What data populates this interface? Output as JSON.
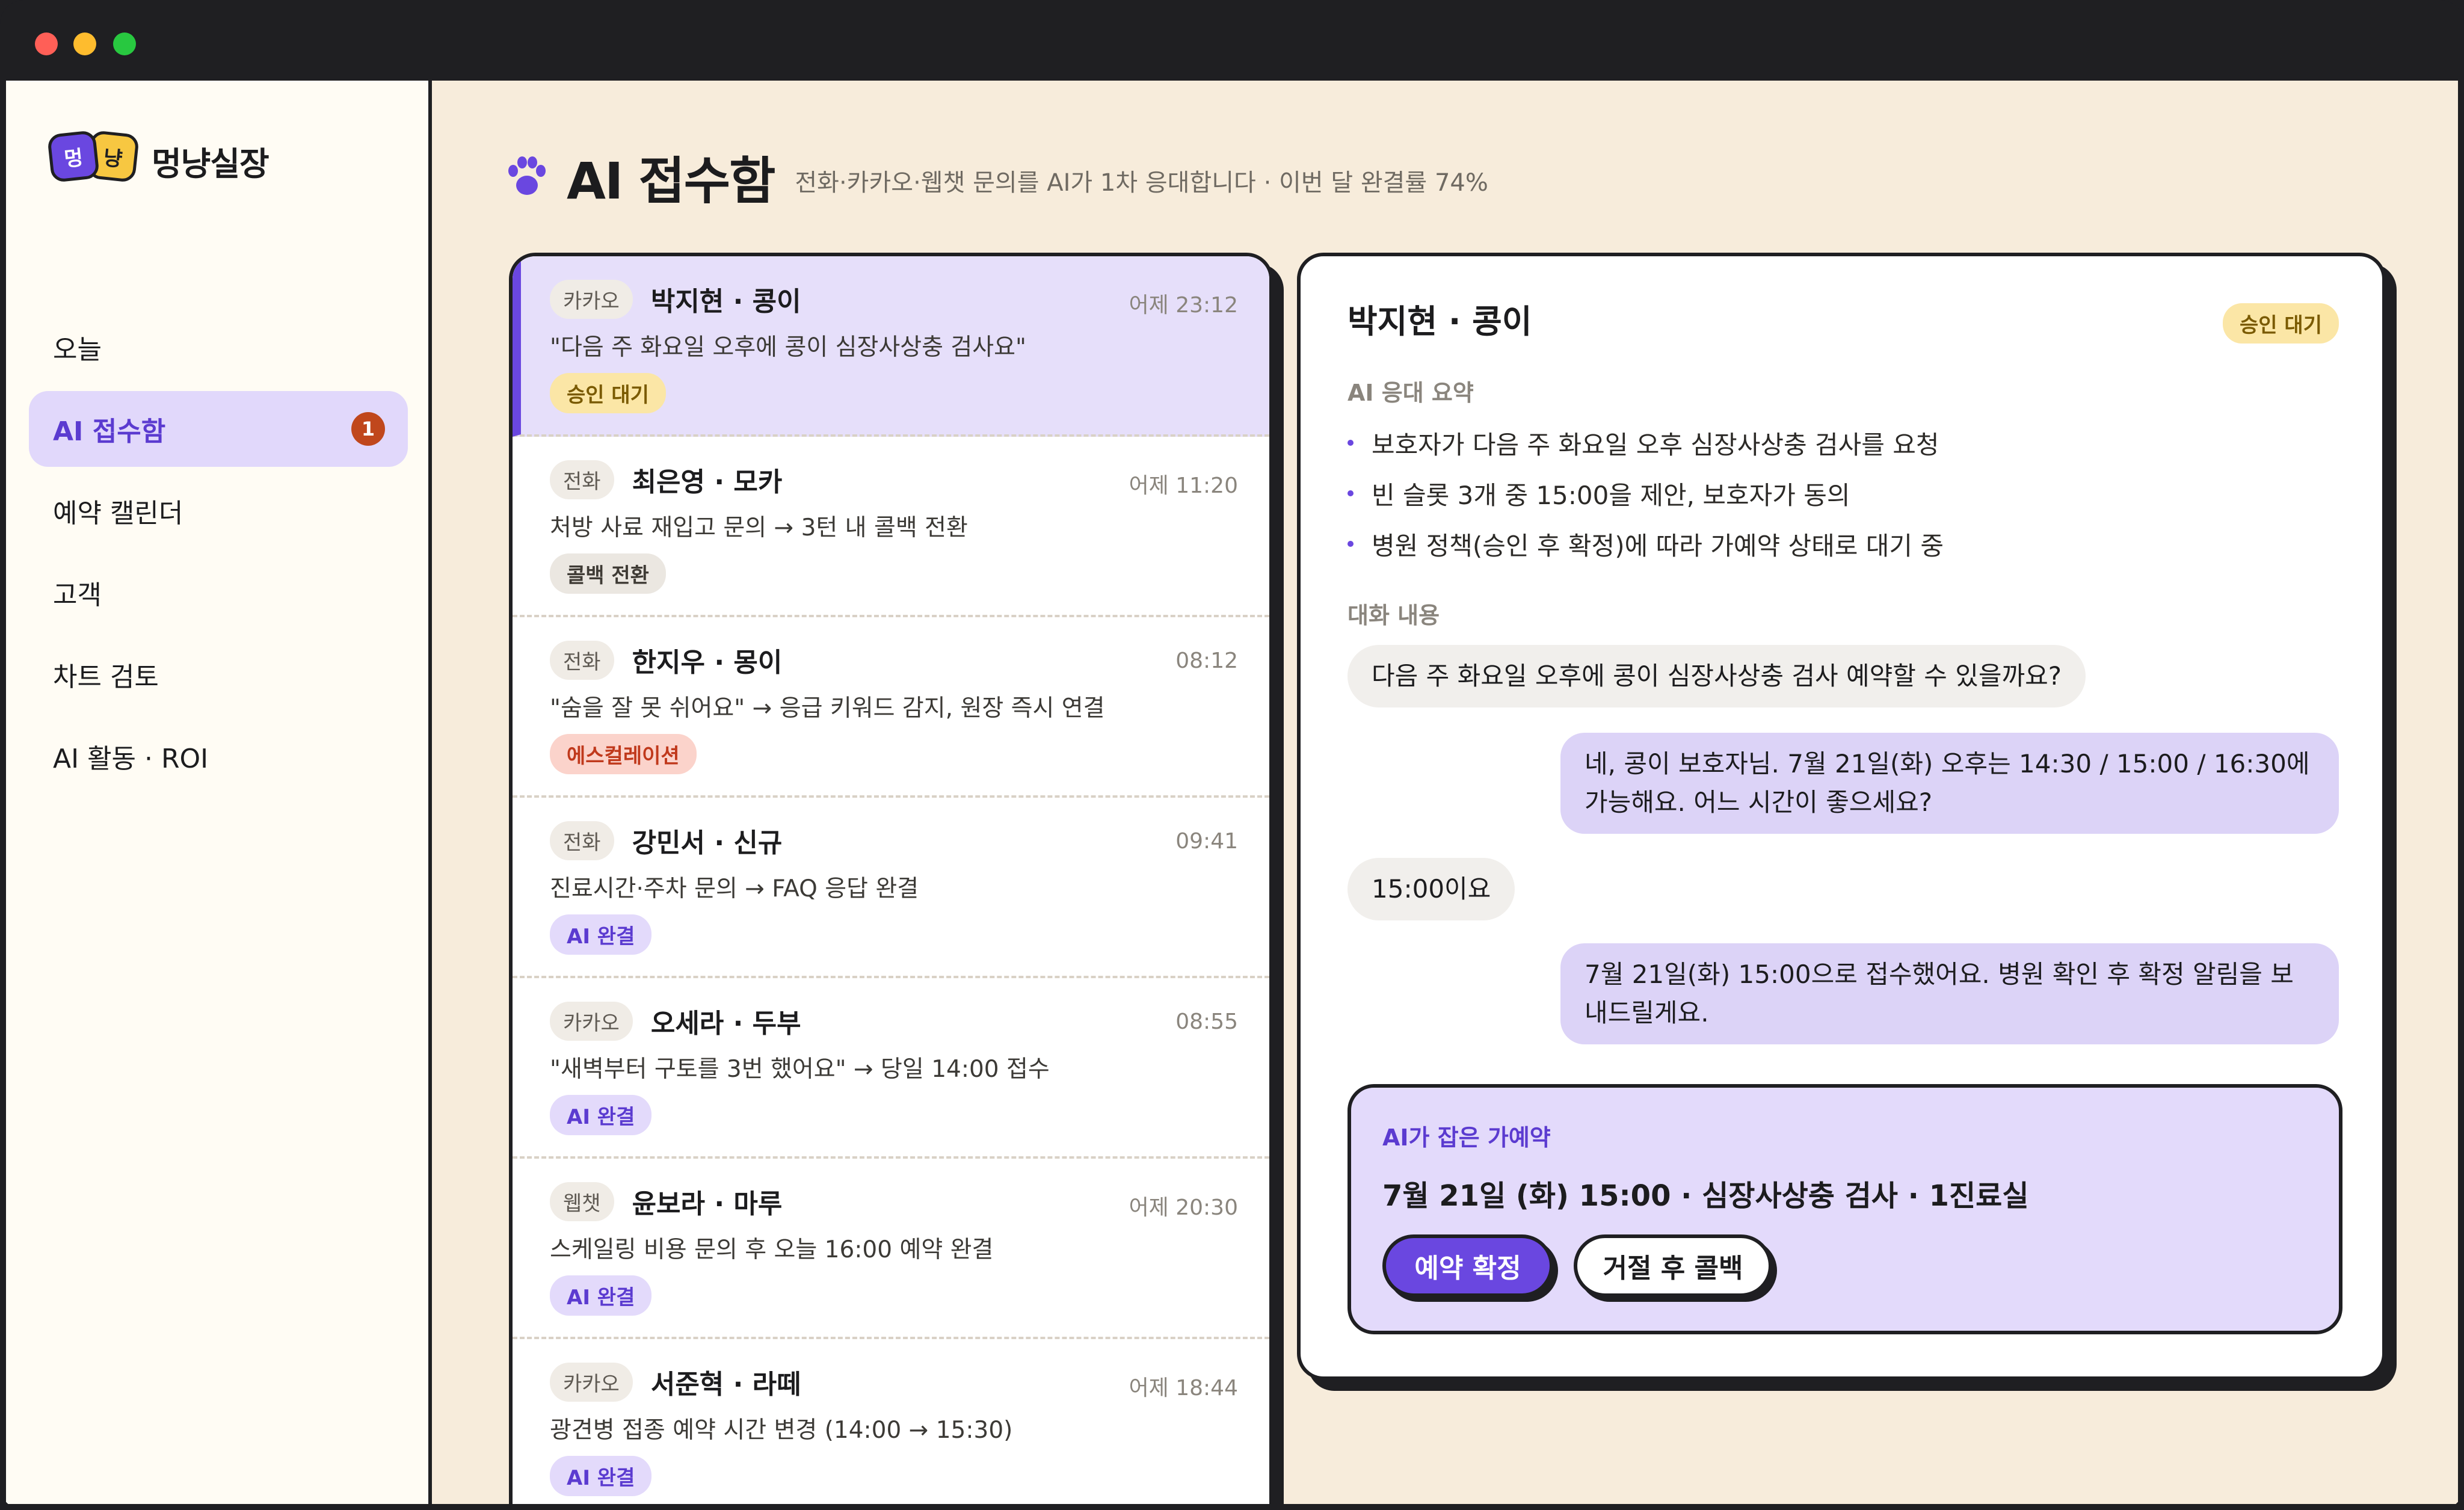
{
  "app": {
    "logo_badge_1": "멍",
    "logo_badge_2": "냥",
    "logo_text": "멍냥실장"
  },
  "sidebar": {
    "items": [
      {
        "label": "오늘"
      },
      {
        "label": "AI 접수함",
        "badge": "1"
      },
      {
        "label": "예약 캘린더"
      },
      {
        "label": "고객"
      },
      {
        "label": "차트 검토"
      },
      {
        "label": "AI 활동 · ROI"
      }
    ]
  },
  "header": {
    "title": "AI 접수함",
    "subtitle": "전화·카카오·웹챗 문의를 AI가 1차 응대합니다 · 이번 달 완결률 74%",
    "completion_rate_percent": 74
  },
  "inbox": {
    "items": [
      {
        "channel": "카카오",
        "name": "박지현 · 콩이",
        "time": "어제 23:12",
        "desc": "\"다음 주 화요일 오후에 콩이 심장사상충 검사요\"",
        "status": "승인 대기"
      },
      {
        "channel": "전화",
        "name": "최은영 · 모카",
        "time": "어제 11:20",
        "desc": "처방 사료 재입고 문의 → 3턴 내 콜백 전환",
        "status": "콜백 전환"
      },
      {
        "channel": "전화",
        "name": "한지우 · 몽이",
        "time": "08:12",
        "desc": "\"숨을 잘 못 쉬어요\" → 응급 키워드 감지, 원장 즉시 연결",
        "status": "에스컬레이션"
      },
      {
        "channel": "전화",
        "name": "강민서 · 신규",
        "time": "09:41",
        "desc": "진료시간·주차 문의 → FAQ 응답 완결",
        "status": "AI 완결"
      },
      {
        "channel": "카카오",
        "name": "오세라 · 두부",
        "time": "08:55",
        "desc": "\"새벽부터 구토를 3번 했어요\" → 당일 14:00 접수",
        "status": "AI 완결"
      },
      {
        "channel": "웹챗",
        "name": "윤보라 · 마루",
        "time": "어제 20:30",
        "desc": "스케일링 비용 문의 후 오늘 16:00 예약 완결",
        "status": "AI 완결"
      },
      {
        "channel": "카카오",
        "name": "서준혁 · 라떼",
        "time": "어제 18:44",
        "desc": "광견병 접종 예약 시간 변경 (14:00 → 15:30)",
        "status": "AI 완결"
      }
    ]
  },
  "detail": {
    "name": "박지현 · 콩이",
    "status": "승인 대기",
    "summary_label": "AI 응대 요약",
    "summary": [
      "보호자가 다음 주 화요일 오후 심장사상충 검사를 요청",
      "빈 슬롯 3개 중 15:00을 제안, 보호자가 동의",
      "병원 정책(승인 후 확정)에 따라 가예약 상태로 대기 중"
    ],
    "conversation_label": "대화 내용",
    "conversation": [
      {
        "from": "customer",
        "text": "다음 주 화요일 오후에 콩이 심장사상충 검사 예약할 수 있을까요?"
      },
      {
        "from": "ai",
        "text": "네, 콩이 보호자님. 7월 21일(화) 오후는 14:30 / 15:00 / 16:30에 가능해요. 어느 시간이 좋으세요?"
      },
      {
        "from": "customer",
        "text": "15:00이요"
      },
      {
        "from": "ai",
        "text": "7월 21일(화) 15:00으로 접수했어요. 병원 확인 후 확정 알림을 보내드릴게요."
      }
    ],
    "reservation": {
      "label": "AI가 잡은 가예약",
      "detail": "7월 21일 (화) 15:00 · 심장사상충 검사 · 1진료실",
      "confirm_label": "예약 확정",
      "reject_label": "거절 후 콜백"
    }
  },
  "colors": {
    "accent": "#6a47e0",
    "background": "#f7ecdb",
    "pending": "#fbe6a6",
    "escalate": "#c0391c"
  }
}
